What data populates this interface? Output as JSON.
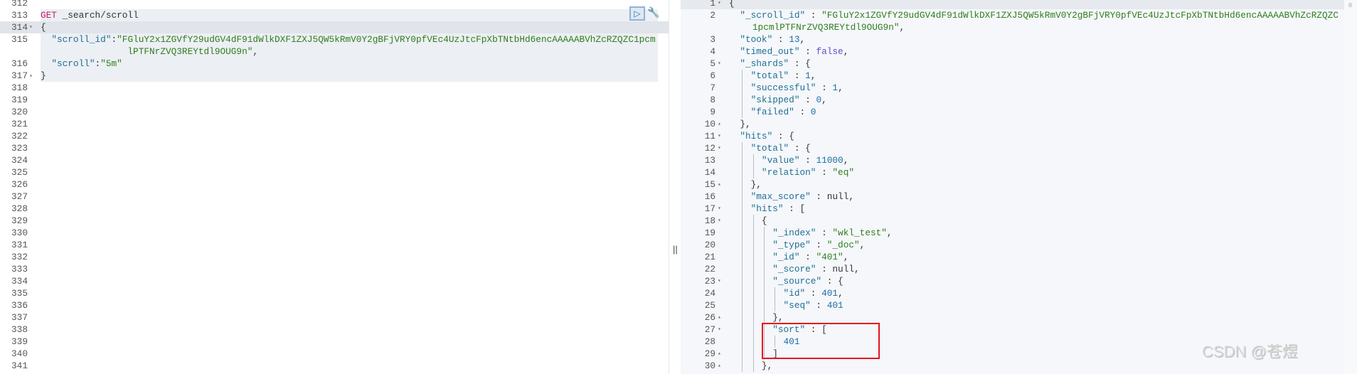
{
  "request_editor": {
    "run_icon": "play-icon",
    "settings_icon": "wrench-icon",
    "lines": [
      {
        "n": "312",
        "t": []
      },
      {
        "n": "313",
        "t": [
          [
            "m",
            "GET"
          ],
          [
            "t",
            " _search/scroll"
          ]
        ]
      },
      {
        "n": "314",
        "f": "open",
        "t": [
          [
            "p",
            "{"
          ]
        ]
      },
      {
        "n": "315",
        "t": [
          [
            "t",
            "  "
          ],
          [
            "k",
            "\"scroll_id\""
          ],
          [
            "p",
            ":"
          ],
          [
            "s",
            "\"FGluY2x1ZGVfY29udGV4dF91dWlkDXF1ZXJ5QW5kRmV0Y2gBFjVRY0pfVEc4UzJtcFpXbTNtbHd6encAAAAABVhZcRZQZC1pcm"
          ]
        ]
      },
      {
        "n": "",
        "w": true,
        "t": [
          [
            "s",
            "lPTFNrZVQ3REYtdl9OUG9n\""
          ],
          [
            "p",
            ","
          ]
        ]
      },
      {
        "n": "316",
        "t": [
          [
            "t",
            "  "
          ],
          [
            "k",
            "\"scroll\""
          ],
          [
            "p",
            ":"
          ],
          [
            "s",
            "\"5m\""
          ]
        ]
      },
      {
        "n": "317",
        "f": "close",
        "t": [
          [
            "p",
            "}"
          ]
        ]
      },
      {
        "n": "318",
        "t": []
      },
      {
        "n": "319",
        "t": []
      },
      {
        "n": "320",
        "t": []
      },
      {
        "n": "321",
        "t": []
      },
      {
        "n": "322",
        "t": []
      },
      {
        "n": "323",
        "t": []
      },
      {
        "n": "324",
        "t": []
      },
      {
        "n": "325",
        "t": []
      },
      {
        "n": "326",
        "t": []
      },
      {
        "n": "327",
        "t": []
      },
      {
        "n": "328",
        "t": []
      },
      {
        "n": "329",
        "t": []
      },
      {
        "n": "330",
        "t": []
      },
      {
        "n": "331",
        "t": []
      },
      {
        "n": "332",
        "t": []
      },
      {
        "n": "333",
        "t": []
      },
      {
        "n": "334",
        "t": []
      },
      {
        "n": "335",
        "t": []
      },
      {
        "n": "336",
        "t": []
      },
      {
        "n": "337",
        "t": []
      },
      {
        "n": "338",
        "t": []
      },
      {
        "n": "339",
        "t": []
      },
      {
        "n": "340",
        "t": []
      },
      {
        "n": "341",
        "t": []
      }
    ]
  },
  "splitter_label": "||",
  "response_viewer": {
    "lines": [
      {
        "n": "1",
        "f": "open",
        "t": [
          [
            "p",
            "{"
          ]
        ]
      },
      {
        "n": "2",
        "t": [
          [
            "t",
            "  "
          ],
          [
            "k",
            "\"_scroll_id\""
          ],
          [
            "p",
            " : "
          ],
          [
            "s",
            "\"FGluY2x1ZGVfY29udGV4dF91dWlkDXF1ZXJ5QW5kRmV0Y2gBFjVRY0pfVEc4UzJtcFpXbTNtbHd6encAAAAABVhZcRZQZC"
          ]
        ]
      },
      {
        "n": "",
        "w": true,
        "t": [
          [
            "s",
            "1pcmlPTFNrZVQ3REYtdl9OUG9n\""
          ],
          [
            "p",
            ","
          ]
        ]
      },
      {
        "n": "3",
        "t": [
          [
            "t",
            "  "
          ],
          [
            "k",
            "\"took\""
          ],
          [
            "p",
            " : "
          ],
          [
            "n",
            "13"
          ],
          [
            "p",
            ","
          ]
        ]
      },
      {
        "n": "4",
        "t": [
          [
            "t",
            "  "
          ],
          [
            "k",
            "\"timed_out\""
          ],
          [
            "p",
            " : "
          ],
          [
            "b",
            "false"
          ],
          [
            "p",
            ","
          ]
        ]
      },
      {
        "n": "5",
        "f": "open",
        "t": [
          [
            "t",
            "  "
          ],
          [
            "k",
            "\"_shards\""
          ],
          [
            "p",
            " : {"
          ]
        ]
      },
      {
        "n": "6",
        "t": [
          [
            "t",
            "    "
          ],
          [
            "k",
            "\"total\""
          ],
          [
            "p",
            " : "
          ],
          [
            "n",
            "1"
          ],
          [
            "p",
            ","
          ]
        ]
      },
      {
        "n": "7",
        "t": [
          [
            "t",
            "    "
          ],
          [
            "k",
            "\"successful\""
          ],
          [
            "p",
            " : "
          ],
          [
            "n",
            "1"
          ],
          [
            "p",
            ","
          ]
        ]
      },
      {
        "n": "8",
        "t": [
          [
            "t",
            "    "
          ],
          [
            "k",
            "\"skipped\""
          ],
          [
            "p",
            " : "
          ],
          [
            "n",
            "0"
          ],
          [
            "p",
            ","
          ]
        ]
      },
      {
        "n": "9",
        "t": [
          [
            "t",
            "    "
          ],
          [
            "k",
            "\"failed\""
          ],
          [
            "p",
            " : "
          ],
          [
            "n",
            "0"
          ]
        ]
      },
      {
        "n": "10",
        "f": "close",
        "t": [
          [
            "t",
            "  "
          ],
          [
            "p",
            "},"
          ]
        ]
      },
      {
        "n": "11",
        "f": "open",
        "t": [
          [
            "t",
            "  "
          ],
          [
            "k",
            "\"hits\""
          ],
          [
            "p",
            " : {"
          ]
        ]
      },
      {
        "n": "12",
        "f": "open",
        "t": [
          [
            "t",
            "    "
          ],
          [
            "k",
            "\"total\""
          ],
          [
            "p",
            " : {"
          ]
        ]
      },
      {
        "n": "13",
        "t": [
          [
            "t",
            "      "
          ],
          [
            "k",
            "\"value\""
          ],
          [
            "p",
            " : "
          ],
          [
            "n",
            "11000"
          ],
          [
            "p",
            ","
          ]
        ]
      },
      {
        "n": "14",
        "t": [
          [
            "t",
            "      "
          ],
          [
            "k",
            "\"relation\""
          ],
          [
            "p",
            " : "
          ],
          [
            "s",
            "\"eq\""
          ]
        ]
      },
      {
        "n": "15",
        "f": "close",
        "t": [
          [
            "t",
            "    "
          ],
          [
            "p",
            "},"
          ]
        ]
      },
      {
        "n": "16",
        "t": [
          [
            "t",
            "    "
          ],
          [
            "k",
            "\"max_score\""
          ],
          [
            "p",
            " : "
          ],
          [
            "t",
            "null"
          ],
          [
            "p",
            ","
          ]
        ]
      },
      {
        "n": "17",
        "f": "open",
        "t": [
          [
            "t",
            "    "
          ],
          [
            "k",
            "\"hits\""
          ],
          [
            "p",
            " : ["
          ]
        ]
      },
      {
        "n": "18",
        "f": "open",
        "t": [
          [
            "t",
            "      "
          ],
          [
            "p",
            "{"
          ]
        ]
      },
      {
        "n": "19",
        "t": [
          [
            "t",
            "        "
          ],
          [
            "k",
            "\"_index\""
          ],
          [
            "p",
            " : "
          ],
          [
            "s",
            "\"wkl_test\""
          ],
          [
            "p",
            ","
          ]
        ]
      },
      {
        "n": "20",
        "t": [
          [
            "t",
            "        "
          ],
          [
            "k",
            "\"_type\""
          ],
          [
            "p",
            " : "
          ],
          [
            "s",
            "\"_doc\""
          ],
          [
            "p",
            ","
          ]
        ]
      },
      {
        "n": "21",
        "t": [
          [
            "t",
            "        "
          ],
          [
            "k",
            "\"_id\""
          ],
          [
            "p",
            " : "
          ],
          [
            "s",
            "\"401\""
          ],
          [
            "p",
            ","
          ]
        ]
      },
      {
        "n": "22",
        "t": [
          [
            "t",
            "        "
          ],
          [
            "k",
            "\"_score\""
          ],
          [
            "p",
            " : "
          ],
          [
            "t",
            "null"
          ],
          [
            "p",
            ","
          ]
        ]
      },
      {
        "n": "23",
        "f": "open",
        "t": [
          [
            "t",
            "        "
          ],
          [
            "k",
            "\"_source\""
          ],
          [
            "p",
            " : {"
          ]
        ]
      },
      {
        "n": "24",
        "t": [
          [
            "t",
            "          "
          ],
          [
            "k",
            "\"id\""
          ],
          [
            "p",
            " : "
          ],
          [
            "n",
            "401"
          ],
          [
            "p",
            ","
          ]
        ]
      },
      {
        "n": "25",
        "t": [
          [
            "t",
            "          "
          ],
          [
            "k",
            "\"seq\""
          ],
          [
            "p",
            " : "
          ],
          [
            "n",
            "401"
          ]
        ]
      },
      {
        "n": "26",
        "f": "close",
        "t": [
          [
            "t",
            "        "
          ],
          [
            "p",
            "},"
          ]
        ]
      },
      {
        "n": "27",
        "f": "open",
        "t": [
          [
            "t",
            "        "
          ],
          [
            "k",
            "\"sort\""
          ],
          [
            "p",
            " : ["
          ]
        ]
      },
      {
        "n": "28",
        "t": [
          [
            "t",
            "          "
          ],
          [
            "n",
            "401"
          ]
        ]
      },
      {
        "n": "29",
        "f": "close",
        "t": [
          [
            "t",
            "        "
          ],
          [
            "p",
            "]"
          ]
        ]
      },
      {
        "n": "30",
        "f": "close",
        "t": [
          [
            "t",
            "      "
          ],
          [
            "p",
            "},"
          ]
        ]
      }
    ]
  },
  "fold_glyphs": {
    "open": "▾",
    "close": "▴"
  },
  "run_glyph": "▷",
  "wrench_glyph": "🔧",
  "watermark": "CSDN @苍煜",
  "colors": {
    "highlight_box": "#e8141d",
    "key": "#1f6f95",
    "string": "#2f7d1f",
    "number": "#1c6ea4",
    "method": "#c41a66"
  }
}
